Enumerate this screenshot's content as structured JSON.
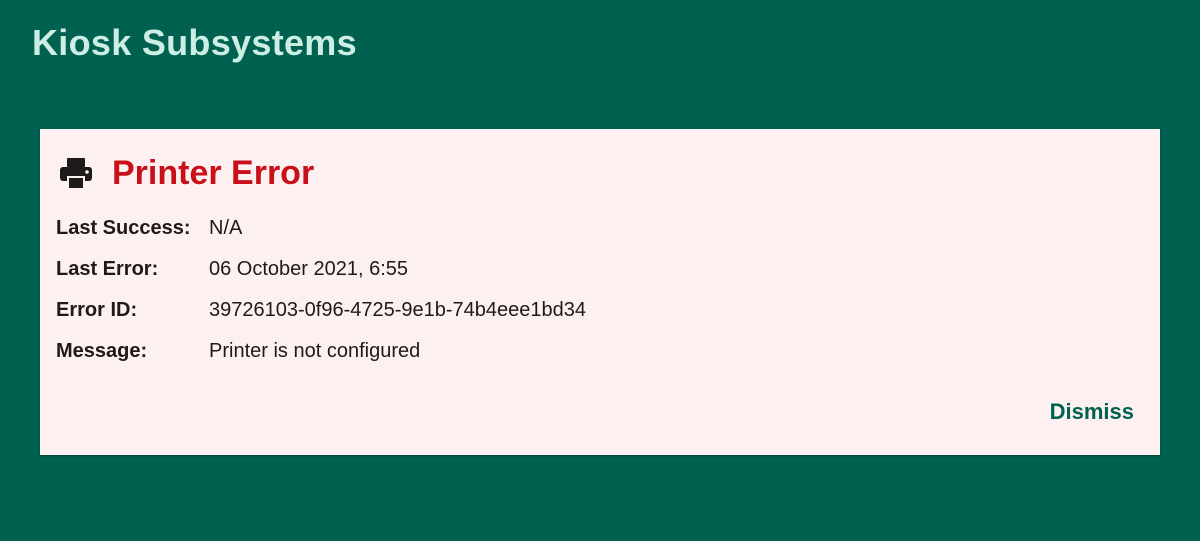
{
  "page": {
    "title": "Kiosk Subsystems"
  },
  "error_card": {
    "icon": "printer-icon",
    "title": "Printer Error",
    "title_color": "#c8101a",
    "rows": [
      {
        "label": "Last Success:",
        "value": "N/A"
      },
      {
        "label": "Last Error:",
        "value": "06 October 2021, 6:55"
      },
      {
        "label": "Error ID:",
        "value": "39726103-0f96-4725-9e1b-74b4eee1bd34"
      },
      {
        "label": "Message:",
        "value": "Printer is not configured"
      }
    ],
    "dismiss_label": "Dismiss"
  },
  "colors": {
    "background": "#006151",
    "card_background": "#fdf0f0",
    "accent": "#006151",
    "error": "#c8101a"
  }
}
